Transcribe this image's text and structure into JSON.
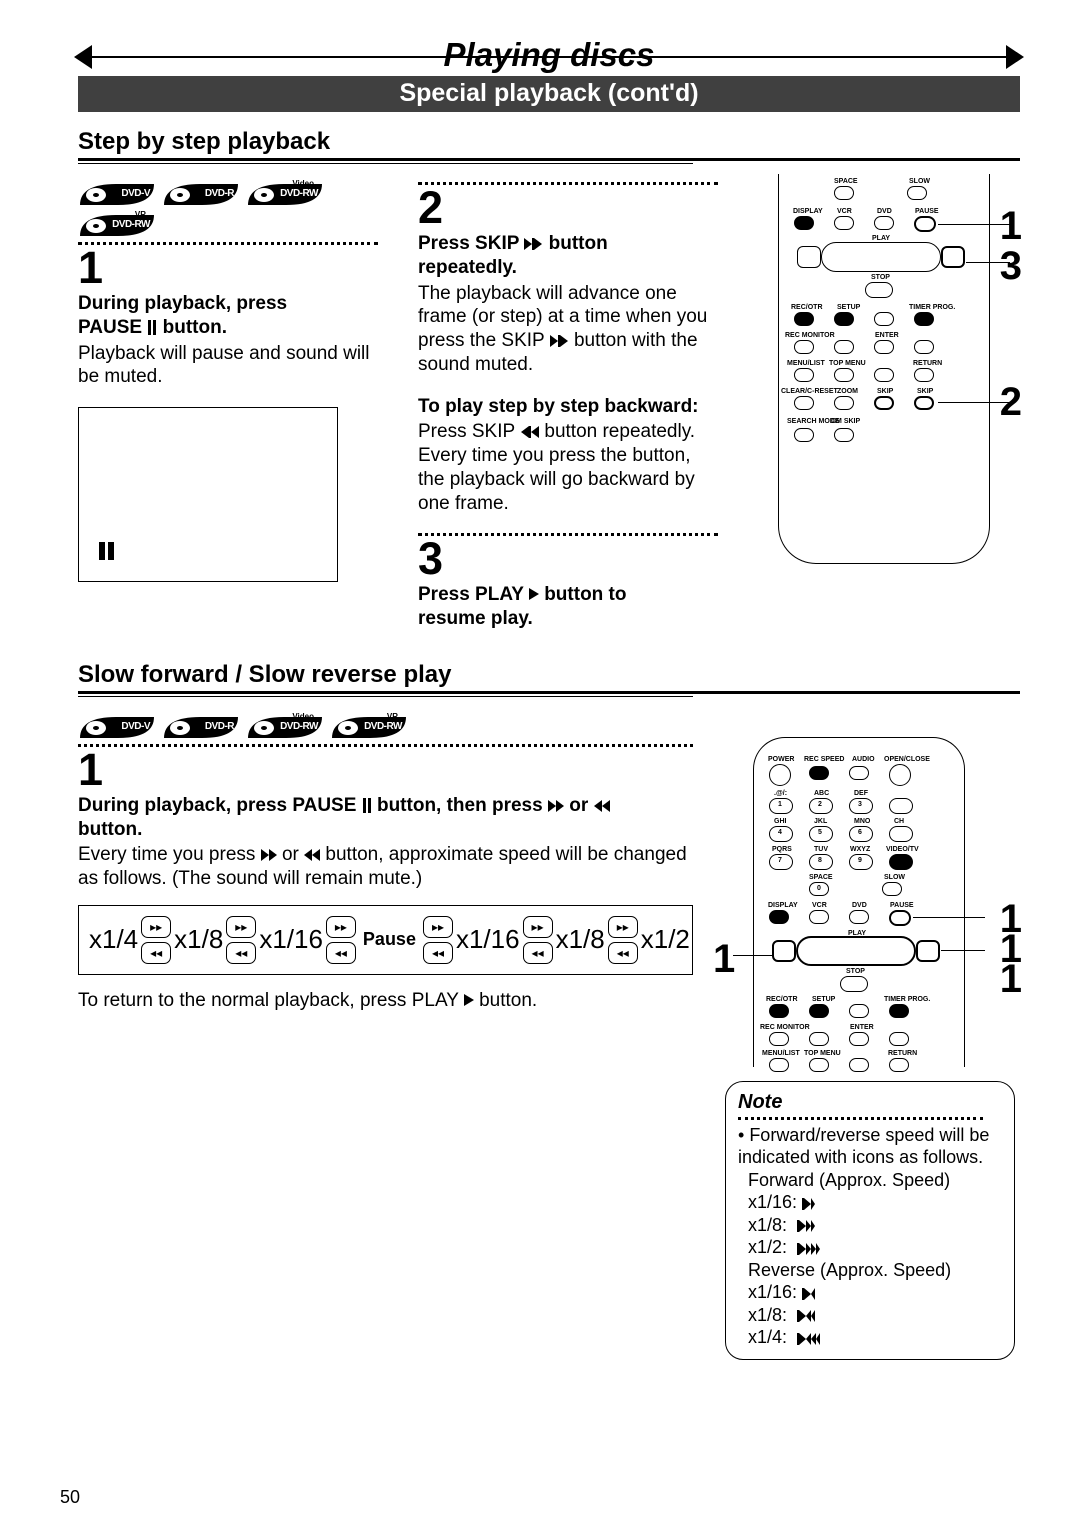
{
  "header": {
    "main_title": "Playing discs",
    "sub_title": "Special playback (cont'd)"
  },
  "step_section": {
    "title": "Step by step playback",
    "badges": [
      "DVD-V",
      "DVD-R",
      "DVD-RW",
      "DVD-RW"
    ],
    "badge_sup": [
      "",
      "",
      "Video",
      "VR"
    ],
    "step1_num": "1",
    "step1_head_a": "During playback, press",
    "step1_head_b": "PAUSE ",
    "step1_head_c": " button.",
    "step1_body": "Playback will pause and sound will be muted.",
    "step2_num": "2",
    "step2_head_a": "Press SKIP ",
    "step2_head_b": " button",
    "step2_head_c": "repeatedly.",
    "step2_body": "The playback will advance one frame (or step) at a time when you press the SKIP ",
    "step2_body_b": " button with the sound muted.",
    "step2_back_head": "To play step by step back­ward:",
    "step2_back_body_a": "Press SKIP ",
    "step2_back_body_b": " button repeatedly. Every time you press the button, the playback will go backward by one frame.",
    "step3_num": "3",
    "step3_head_a": "Press PLAY ",
    "step3_head_b": " button to",
    "step3_head_c": "resume play."
  },
  "slow_section": {
    "title": "Slow forward / Slow reverse play",
    "badges": [
      "DVD-V",
      "DVD-R",
      "DVD-RW",
      "DVD-RW"
    ],
    "badge_sup": [
      "",
      "",
      "Video",
      "VR"
    ],
    "step1_num": "1",
    "step1_head_a": "During playback, press PAUSE ",
    "step1_head_b": " button, then press ",
    "step1_head_c": " or ",
    "step1_head_d": "button.",
    "step1_body_a": "Every time you press ",
    "step1_body_b": " or ",
    "step1_body_c": " button, approximate speed will be changed as follows. (The sound will remain mute.)",
    "speeds_left": [
      "x1/4",
      "x1/8",
      "x1/16"
    ],
    "pause_label": "Pause",
    "speeds_right": [
      "x1/16",
      "x1/8",
      "x1/2"
    ],
    "return_text_a": "To return to the normal playback, press PLAY ",
    "return_text_b": " button."
  },
  "remote": {
    "labels_row1": [
      "SPACE",
      "SLOW"
    ],
    "labels_row2": [
      "DISPLAY",
      "VCR",
      "DVD",
      "PAUSE"
    ],
    "labels_play": "PLAY",
    "labels_stop": "STOP",
    "labels_row3": [
      "REC/OTR",
      "SETUP",
      "",
      "TIMER PROG."
    ],
    "labels_row4": [
      "REC MONITOR",
      "",
      "ENTER",
      ""
    ],
    "labels_row5": [
      "MENU/LIST",
      "TOP MENU",
      "",
      "RETURN"
    ],
    "labels_row6": [
      "CLEAR/C-RESET",
      "ZOOM",
      "SKIP",
      "SKIP"
    ],
    "labels_row7": [
      "SEARCH MODE",
      "CM SKIP"
    ],
    "top_labels": [
      "POWER",
      "REC SPEED",
      "AUDIO",
      "OPEN/CLOSE"
    ],
    "num_labels": [
      ".@/:",
      "ABC",
      "DEF",
      "",
      "GHI",
      "JKL",
      "MNO",
      "CH",
      "PQRS",
      "TUV",
      "WXYZ",
      "VIDEO/TV"
    ],
    "nums": [
      "1",
      "2",
      "3",
      "",
      "4",
      "5",
      "6",
      "",
      "7",
      "8",
      "9",
      ""
    ],
    "zero": "0",
    "callouts_a": [
      "1",
      "3",
      "2"
    ],
    "callouts_b": [
      "1",
      "1",
      "1",
      "1"
    ]
  },
  "note": {
    "title": "Note",
    "line1": "Forward/reverse speed will be indicated with icons as follows.",
    "fwd_title": "Forward (Approx. Speed)",
    "fwd": [
      "x1/16:",
      "x1/8:",
      "x1/2:"
    ],
    "rev_title": "Reverse (Approx. Speed)",
    "rev": [
      "x1/16:",
      "x1/8:",
      "x1/4:"
    ]
  },
  "page_num": "50"
}
